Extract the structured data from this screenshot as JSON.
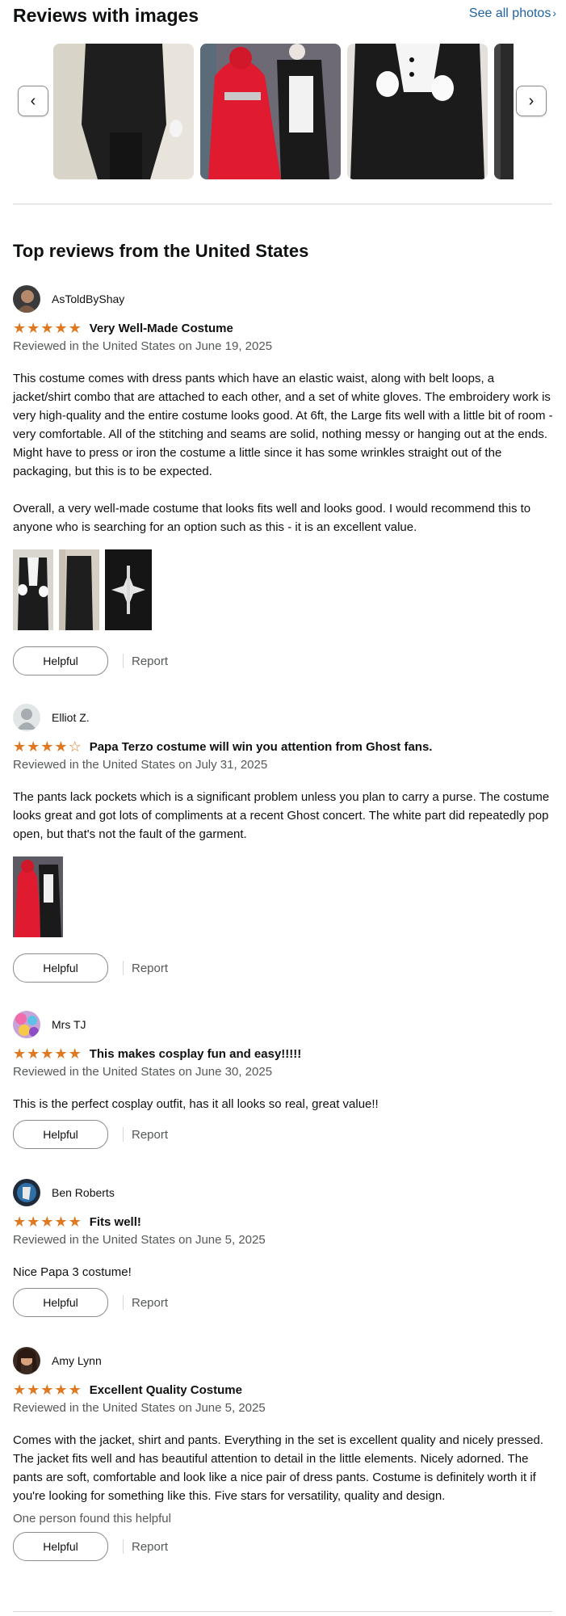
{
  "header": {
    "title": "Reviews with images",
    "see_all": "See all photos",
    "see_all_chevron": "›"
  },
  "carousel": {
    "prev_icon": "chevron-left-icon",
    "next_icon": "chevron-right-icon",
    "prev_glyph": "‹",
    "next_glyph": "›"
  },
  "top_reviews_title": "Top reviews from the United States",
  "reviews": [
    {
      "name": "AsToldByShay",
      "rating": 5,
      "title": "Very Well-Made Costume",
      "date": "Reviewed in the United States on June 19, 2025",
      "body1": "This costume comes with dress pants which have an elastic waist, along with belt loops, a jacket/shirt combo that are attached to each other, and a set of white gloves. The embroidery work is very high-quality and the entire costume looks good. At 6ft, the Large fits well with a little bit of room - very comfortable. All of the stitching and seams are solid, nothing messy or hanging out at the ends. Might have to press or iron the costume a little since it has some wrinkles straight out of the packaging, but this is to be expected.",
      "body2": "Overall, a very well-made costume that looks fits well and looks good. I would recommend this to anyone who is searching for an option such as this - it is an excellent value.",
      "helpful": "Helpful",
      "report": "Report"
    },
    {
      "name": "Elliot Z.",
      "rating": 4,
      "title": "Papa Terzo costume will win you attention from Ghost fans.",
      "date": "Reviewed in the United States on July 31, 2025",
      "body1": "The pants lack pockets which is a significant problem unless you plan to carry a purse. The costume looks great and got lots of compliments at a recent Ghost concert. The white part did repeatedly pop open, but that's not the fault of the garment.",
      "helpful": "Helpful",
      "report": "Report"
    },
    {
      "name": "Mrs TJ",
      "rating": 5,
      "title": "This makes cosplay fun and easy!!!!!",
      "date": "Reviewed in the United States on June 30, 2025",
      "body1": "This is the perfect cosplay outfit, has it all looks so real, great value!!",
      "helpful": "Helpful",
      "report": "Report"
    },
    {
      "name": "Ben Roberts",
      "rating": 5,
      "title": "Fits well!",
      "date": "Reviewed in the United States on June 5, 2025",
      "body1": "Nice Papa 3 costume!",
      "helpful": "Helpful",
      "report": "Report"
    },
    {
      "name": "Amy Lynn",
      "rating": 5,
      "title": "Excellent Quality Costume",
      "date": "Reviewed in the United States on June 5, 2025",
      "body1": "Comes with the jacket, shirt and pants. Everything in the set is excellent quality and nicely pressed. The jacket fits well and has beautiful attention to detail in the little elements. Nicely adorned. The pants are soft, comfortable and look like a nice pair of dress pants. Costume is definitely worth it if you're looking for something like this. Five stars for versatility, quality and design.",
      "found_helpful": "One person found this helpful",
      "helpful": "Helpful",
      "report": "Report"
    }
  ],
  "colors": {
    "star": "#DE7921",
    "link": "#2162A1",
    "secondary_text": "#565959",
    "border": "#888C8C"
  }
}
